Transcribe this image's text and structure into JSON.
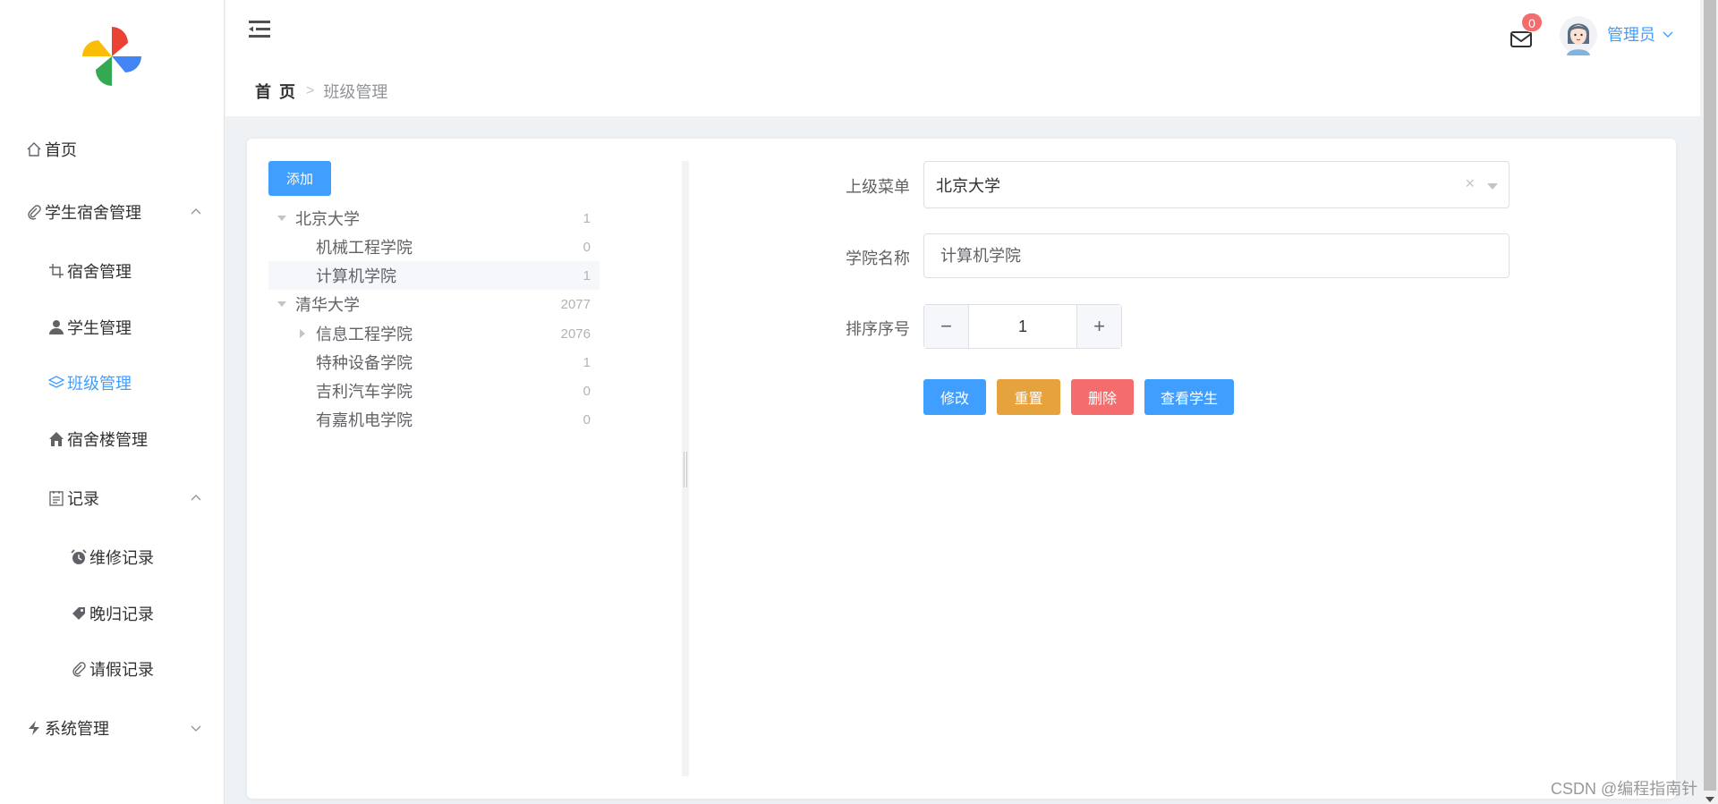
{
  "sidebar": {
    "items": [
      {
        "label": "首页"
      },
      {
        "label": "学生宿舍管理"
      },
      {
        "label": "宿舍管理"
      },
      {
        "label": "学生管理"
      },
      {
        "label": "班级管理"
      },
      {
        "label": "宿舍楼管理"
      },
      {
        "label": "记录"
      },
      {
        "label": "维修记录"
      },
      {
        "label": "晚归记录"
      },
      {
        "label": "请假记录"
      },
      {
        "label": "系统管理"
      }
    ],
    "active_color": "#409eff"
  },
  "header": {
    "breadcrumb_home": "首 页",
    "breadcrumb_current": "班级管理",
    "mail_badge": "0",
    "user_name": "管理员"
  },
  "tree": {
    "add_label": "添加",
    "nodes": [
      {
        "label": "北京大学",
        "count": "1"
      },
      {
        "label": "机械工程学院",
        "count": "0"
      },
      {
        "label": "计算机学院",
        "count": "1"
      },
      {
        "label": "清华大学",
        "count": "2077"
      },
      {
        "label": "信息工程学院",
        "count": "2076"
      },
      {
        "label": "特种设备学院",
        "count": "1"
      },
      {
        "label": "吉利汽车学院",
        "count": "0"
      },
      {
        "label": "有嘉机电学院",
        "count": "0"
      }
    ]
  },
  "form": {
    "parent_label": "上级菜单",
    "parent_value": "北京大学",
    "name_label": "学院名称",
    "name_value": "计算机学院",
    "order_label": "排序序号",
    "order_value": "1",
    "edit_label": "修改",
    "reset_label": "重置",
    "delete_label": "删除",
    "view_label": "查看学生"
  },
  "watermark": "CSDN @编程指南针"
}
